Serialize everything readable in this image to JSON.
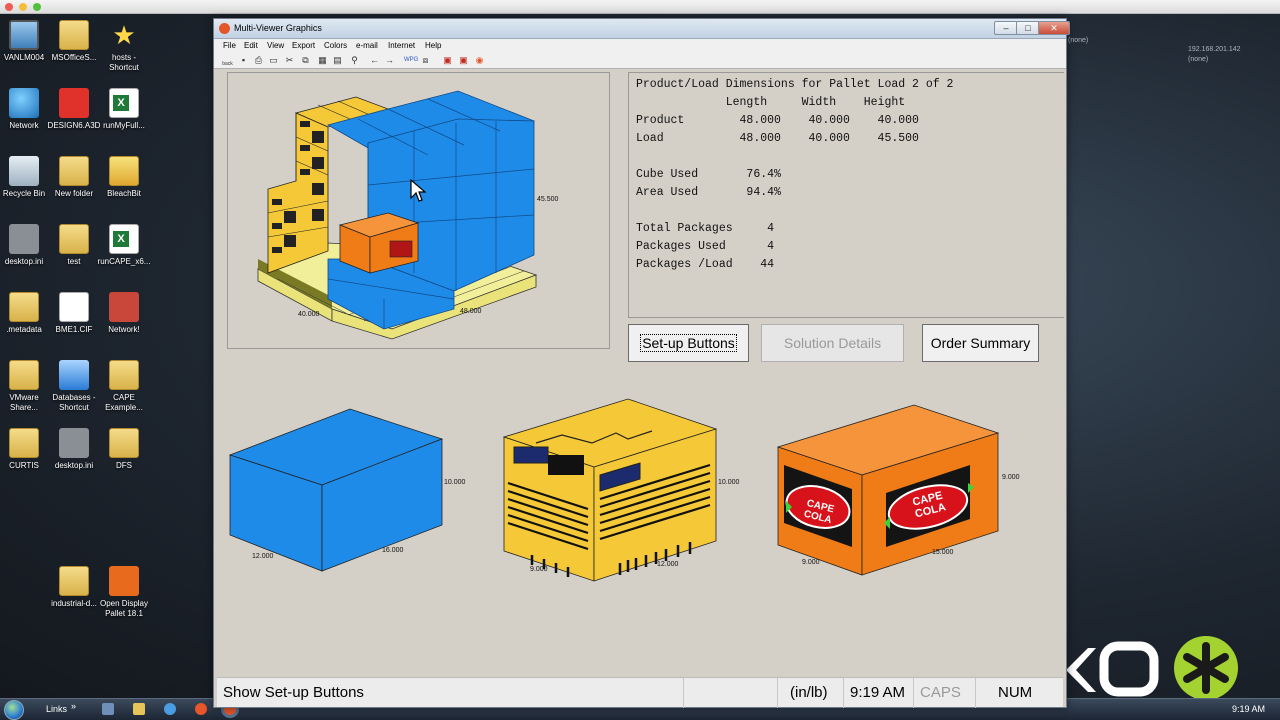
{
  "desktop": {
    "icons": [
      {
        "label": "VANLM004",
        "icon": "monitor-icon"
      },
      {
        "label": "MSOfficeS...",
        "icon": "folder-icon"
      },
      {
        "label": "hosts - Shortcut",
        "icon": "star-icon"
      },
      {
        "label": "Network",
        "icon": "globe-icon"
      },
      {
        "label": "DESIGN6.A3D",
        "icon": "cape-app-icon"
      },
      {
        "label": "runMyFull...",
        "icon": "excel-icon"
      },
      {
        "label": "Recycle Bin",
        "icon": "recycle-bin-icon"
      },
      {
        "label": "New folder",
        "icon": "folder-icon"
      },
      {
        "label": "BleachBit",
        "icon": "broom-icon"
      },
      {
        "label": "desktop.ini",
        "icon": "gear-file-icon"
      },
      {
        "label": "test",
        "icon": "folder-icon"
      },
      {
        "label": "runCAPE_x6...",
        "icon": "excel-icon"
      },
      {
        "label": ".metadata",
        "icon": "folder-icon"
      },
      {
        "label": "BME1.CIF",
        "icon": "document-icon"
      },
      {
        "label": "Network!",
        "icon": "home-network-icon"
      },
      {
        "label": "VMware Share...",
        "icon": "folder-shortcut-icon"
      },
      {
        "label": "Databases - Shortcut",
        "icon": "database-shortcut-icon"
      },
      {
        "label": "CAPE Example...",
        "icon": "folder-icon"
      },
      {
        "label": "CURTIS",
        "icon": "folder-icon"
      },
      {
        "label": "desktop.ini",
        "icon": "gear-file-icon"
      },
      {
        "label": "DFS",
        "icon": "folder-icon"
      },
      {
        "label": "industrial-d...",
        "icon": "folder-icon"
      },
      {
        "label": "Open Display Pallet 18.1",
        "icon": "open-display-icon"
      }
    ],
    "right_info": {
      "ip": "192.168.201.142",
      "none1": "(none)",
      "none2": "(none)"
    }
  },
  "window": {
    "title": "Multi-Viewer Graphics",
    "menu": [
      "File",
      "Edit",
      "View",
      "Export",
      "Colors",
      "e-mail",
      "Internet",
      "Help"
    ],
    "toolbar_back_label": "back"
  },
  "info": {
    "heading": "Product/Load Dimensions for Pallet Load 2 of 2",
    "col_header": "             Length     Width    Height",
    "product_row": "Product        48.000    40.000    40.000",
    "load_row": "Load           48.000    40.000    45.500",
    "cube_used": "Cube Used       76.4%",
    "area_used": "Area Used       94.4%",
    "total_packages": "Total Packages     4",
    "packages_used": "Packages Used      4",
    "packages_load": "Packages /Load    44"
  },
  "buttons": {
    "setup": "Set-up Buttons",
    "solution": "Solution Details",
    "order": "Order Summary"
  },
  "pallet_dims": {
    "height": "45.500",
    "width": "40.000",
    "length": "48.000"
  },
  "packages": [
    {
      "name": "blue-box",
      "height": "10.000",
      "width": "12.000",
      "length": "16.000"
    },
    {
      "name": "yellow-case",
      "height": "10.000",
      "width": "9.000",
      "length": "12.000"
    },
    {
      "name": "orange-case",
      "height": "9.000",
      "width": "9.000",
      "length": "15.000",
      "label_line1": "CAPE",
      "label_line2": "COLA"
    }
  ],
  "status": {
    "message": "Show Set-up Buttons",
    "units": "(in/lb)",
    "time": "9:19 AM",
    "caps": "CAPS",
    "num": "NUM"
  },
  "taskbar": {
    "links": "Links",
    "chevron": "»",
    "clock": "9:19 AM"
  },
  "colors": {
    "blue": "#1e8be8",
    "yellow": "#f4c837",
    "orange": "#f07c17",
    "pallet": "#f2ef9a"
  }
}
